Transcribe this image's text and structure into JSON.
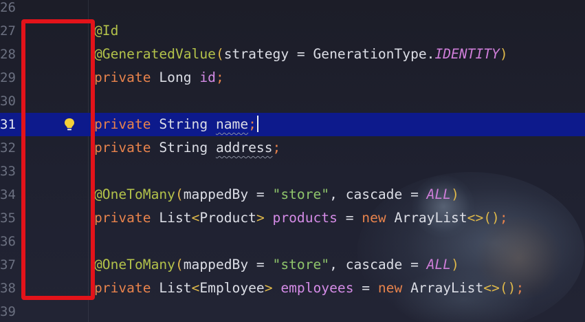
{
  "editor": {
    "lines": [
      {
        "num": "26",
        "tokens": []
      },
      {
        "num": "27",
        "tokens": [
          {
            "t": "@Id",
            "c": "ann"
          }
        ]
      },
      {
        "num": "28",
        "tokens": [
          {
            "t": "@GeneratedValue",
            "c": "ann"
          },
          {
            "t": "(",
            "c": "brace"
          },
          {
            "t": "strategy = GenerationType.",
            "c": "plain"
          },
          {
            "t": "IDENTITY",
            "c": "const"
          },
          {
            "t": ")",
            "c": "brace"
          }
        ]
      },
      {
        "num": "29",
        "tokens": [
          {
            "t": "private ",
            "c": "kw"
          },
          {
            "t": "Long ",
            "c": "plain"
          },
          {
            "t": "id",
            "c": "field"
          },
          {
            "t": ";",
            "c": "kw"
          }
        ]
      },
      {
        "num": "30",
        "tokens": []
      },
      {
        "num": "31",
        "current": true,
        "bulb": true,
        "tokens": [
          {
            "t": "private ",
            "c": "kw"
          },
          {
            "t": "String ",
            "c": "plain"
          },
          {
            "t": "name",
            "c": "plain",
            "u": true
          },
          {
            "t": ";",
            "c": "kw"
          },
          {
            "caret": true
          }
        ]
      },
      {
        "num": "32",
        "tokens": [
          {
            "t": "private ",
            "c": "kw"
          },
          {
            "t": "String ",
            "c": "plain"
          },
          {
            "t": "address",
            "c": "plain",
            "u": true
          },
          {
            "t": ";",
            "c": "kw"
          }
        ]
      },
      {
        "num": "33",
        "tokens": []
      },
      {
        "num": "34",
        "tokens": [
          {
            "t": "@OneToMany",
            "c": "ann"
          },
          {
            "t": "(",
            "c": "brace"
          },
          {
            "t": "mappedBy = ",
            "c": "plain"
          },
          {
            "t": "\"store\"",
            "c": "str"
          },
          {
            "t": ", cascade = ",
            "c": "plain"
          },
          {
            "t": "ALL",
            "c": "const"
          },
          {
            "t": ")",
            "c": "brace"
          }
        ]
      },
      {
        "num": "35",
        "tokens": [
          {
            "t": "private ",
            "c": "kw"
          },
          {
            "t": "List",
            "c": "plain"
          },
          {
            "t": "<",
            "c": "brace"
          },
          {
            "t": "Product",
            "c": "plain"
          },
          {
            "t": "> ",
            "c": "brace"
          },
          {
            "t": "products",
            "c": "field"
          },
          {
            "t": " = ",
            "c": "plain"
          },
          {
            "t": "new ",
            "c": "kw"
          },
          {
            "t": "ArrayList",
            "c": "plain"
          },
          {
            "t": "<>",
            "c": "brace"
          },
          {
            "t": "()",
            "c": "brace"
          },
          {
            "t": ";",
            "c": "kw"
          }
        ]
      },
      {
        "num": "36",
        "tokens": []
      },
      {
        "num": "37",
        "tokens": [
          {
            "t": "@OneToMany",
            "c": "ann"
          },
          {
            "t": "(",
            "c": "brace"
          },
          {
            "t": "mappedBy = ",
            "c": "plain"
          },
          {
            "t": "\"store\"",
            "c": "str"
          },
          {
            "t": ", cascade = ",
            "c": "plain"
          },
          {
            "t": "ALL",
            "c": "const"
          },
          {
            "t": ")",
            "c": "brace"
          }
        ]
      },
      {
        "num": "38",
        "tokens": [
          {
            "t": "private ",
            "c": "kw"
          },
          {
            "t": "List",
            "c": "plain"
          },
          {
            "t": "<",
            "c": "brace"
          },
          {
            "t": "Employee",
            "c": "plain"
          },
          {
            "t": "> ",
            "c": "brace"
          },
          {
            "t": "employees",
            "c": "field"
          },
          {
            "t": " = ",
            "c": "plain"
          },
          {
            "t": "new ",
            "c": "kw"
          },
          {
            "t": "ArrayList",
            "c": "plain"
          },
          {
            "t": "<>",
            "c": "brace"
          },
          {
            "t": "()",
            "c": "brace"
          },
          {
            "t": ";",
            "c": "kw"
          }
        ]
      },
      {
        "num": "39",
        "tokens": []
      }
    ],
    "gutter_icon": "lightbulb-icon",
    "colors": {
      "background": "#1e1f2b",
      "current_line": "#0d1a8c",
      "annotation": "#b3c24a",
      "keyword": "#e8834c",
      "field": "#d48be6",
      "string": "#8fc56b",
      "highlight_box": "#e3131a"
    }
  }
}
